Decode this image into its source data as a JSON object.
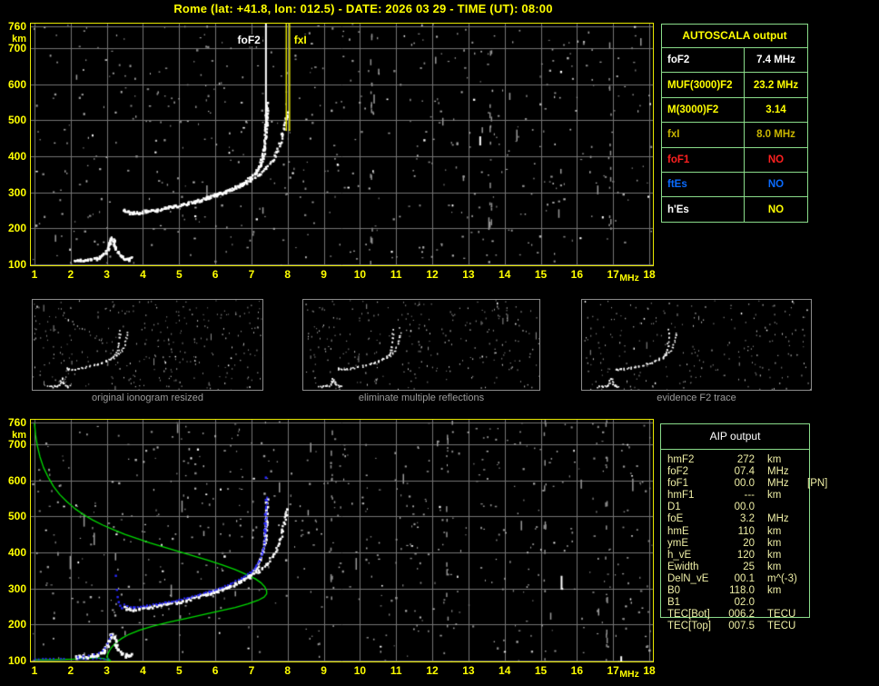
{
  "title": "Rome (lat: +41.8, lon: 012.5) - DATE: 2026 03 29 - TIME (UT): 08:00",
  "colors": {
    "title_yellow": "#ffff00",
    "plot_border": "#e9e900",
    "grid_gray": "#757575",
    "noise_gray": "#989898",
    "trace_white": "#ffffff",
    "profile_green": "#00dd00",
    "restored_blue": "#2828ff",
    "table_border_green": "#8adc8a",
    "aip_text": "#efefa6",
    "caption_gray": "#9c9c9c",
    "red": "#ff2020",
    "blue": "#0a6bff",
    "dark_yellow": "#c8b400"
  },
  "top_plot": {
    "x_ticks": [
      1,
      2,
      3,
      4,
      5,
      6,
      7,
      8,
      9,
      10,
      11,
      12,
      13,
      14,
      15,
      16,
      17,
      18
    ],
    "x_unit": "MHz",
    "y_ticks": [
      760,
      700,
      600,
      500,
      400,
      300,
      200,
      100
    ],
    "y_unit": "km",
    "foF2_label": "foF2",
    "fxI_label": "fxI"
  },
  "bottom_plot": {
    "x_ticks": [
      1,
      2,
      3,
      4,
      5,
      6,
      7,
      8,
      9,
      10,
      11,
      12,
      13,
      14,
      15,
      16,
      17,
      18
    ],
    "x_unit": "MHz",
    "y_ticks": [
      760,
      700,
      600,
      500,
      400,
      300,
      200,
      100
    ],
    "y_unit": "km"
  },
  "thumbnails": [
    {
      "caption": "original ionogram resized"
    },
    {
      "caption": "eliminate multiple reflections"
    },
    {
      "caption": "evidence F2 trace"
    }
  ],
  "autoscala": {
    "title": "AUTOSCALA output",
    "rows": [
      {
        "label": "foF2",
        "value": "7.4 MHz",
        "color": "#ffffff"
      },
      {
        "label": "MUF(3000)F2",
        "value": "23.2 MHz",
        "color": "#ffff00"
      },
      {
        "label": "M(3000)F2",
        "value": "3.14",
        "color": "#ffff00"
      },
      {
        "label": "fxI",
        "value": "8.0 MHz",
        "color": "#c8b400"
      },
      {
        "label": "foF1",
        "value": "NO",
        "color": "#ff2020"
      },
      {
        "label": "ftEs",
        "value": "NO",
        "color": "#0a6bff"
      },
      {
        "label": "h'Es",
        "value": "NO",
        "color": "#ffffff",
        "value_color": "#ffff00"
      }
    ]
  },
  "aip": {
    "title": "AIP output",
    "rows": [
      {
        "label": "hmF2",
        "value": "272",
        "unit": "km",
        "extra": ""
      },
      {
        "label": "foF2",
        "value": "07.4",
        "unit": "MHz",
        "extra": ""
      },
      {
        "label": "foF1",
        "value": "00.0",
        "unit": "MHz",
        "extra": "[PN]"
      },
      {
        "label": "hmF1",
        "value": "---",
        "unit": "km",
        "extra": ""
      },
      {
        "label": "D1",
        "value": "00.0",
        "unit": "",
        "extra": ""
      },
      {
        "label": "foE",
        "value": "3.2",
        "unit": "MHz",
        "extra": ""
      },
      {
        "label": "hmE",
        "value": "110",
        "unit": "km",
        "extra": ""
      },
      {
        "label": "ymE",
        "value": "20",
        "unit": "km",
        "extra": ""
      },
      {
        "label": "h_vE",
        "value": "120",
        "unit": "km",
        "extra": ""
      },
      {
        "label": "Ewidth",
        "value": "25",
        "unit": "km",
        "extra": ""
      },
      {
        "label": "DelN_vE",
        "value": "00.1",
        "unit": "m^(-3)",
        "extra": ""
      },
      {
        "label": "B0",
        "value": "118.0",
        "unit": "km",
        "extra": ""
      },
      {
        "label": "B1",
        "value": "02.0",
        "unit": "",
        "extra": ""
      },
      {
        "label": "TEC[Bot]",
        "value": "006.2",
        "unit": "TECU",
        "extra": ""
      },
      {
        "label": "TEC[Top]",
        "value": "007.5",
        "unit": "TECU",
        "extra": ""
      }
    ]
  },
  "chart_data": {
    "type": "scatter",
    "title": "Ionogram echo traces, virtual height vs frequency",
    "xlabel": "MHz",
    "ylabel": "km",
    "x_range": [
      1,
      18
    ],
    "y_range": [
      100,
      760
    ],
    "markers": {
      "foF2_MHz": 7.4,
      "fxI_MHz": 8.0
    },
    "o_trace": [
      [
        3.45,
        252
      ],
      [
        3.55,
        247
      ],
      [
        3.7,
        244
      ],
      [
        3.9,
        246
      ],
      [
        4.1,
        249
      ],
      [
        4.35,
        253
      ],
      [
        4.6,
        258
      ],
      [
        4.9,
        264
      ],
      [
        5.2,
        271
      ],
      [
        5.5,
        279
      ],
      [
        5.8,
        288
      ],
      [
        6.1,
        298
      ],
      [
        6.4,
        310
      ],
      [
        6.7,
        325
      ],
      [
        6.95,
        342
      ],
      [
        7.1,
        357
      ],
      [
        7.2,
        374
      ],
      [
        7.28,
        396
      ],
      [
        7.33,
        423
      ],
      [
        7.36,
        452
      ],
      [
        7.38,
        487
      ],
      [
        7.39,
        518
      ],
      [
        7.4,
        548
      ]
    ],
    "x_trace": [
      [
        5.75,
        286
      ],
      [
        6.05,
        295
      ],
      [
        6.35,
        306
      ],
      [
        6.65,
        319
      ],
      [
        6.95,
        334
      ],
      [
        7.2,
        351
      ],
      [
        7.4,
        370
      ],
      [
        7.55,
        390
      ],
      [
        7.67,
        412
      ],
      [
        7.76,
        437
      ],
      [
        7.83,
        462
      ],
      [
        7.88,
        487
      ],
      [
        7.93,
        508
      ],
      [
        7.96,
        525
      ]
    ],
    "es_trace": [
      [
        2.1,
        112
      ],
      [
        2.25,
        114
      ],
      [
        2.4,
        113
      ],
      [
        2.55,
        116
      ],
      [
        2.7,
        118
      ],
      [
        2.8,
        122
      ],
      [
        2.9,
        130
      ],
      [
        3.0,
        144
      ],
      [
        3.05,
        160
      ],
      [
        3.1,
        176
      ],
      [
        3.16,
        166
      ],
      [
        3.22,
        149
      ],
      [
        3.28,
        135
      ],
      [
        3.38,
        124
      ],
      [
        3.48,
        117
      ],
      [
        3.58,
        114
      ],
      [
        3.68,
        120
      ]
    ],
    "green_profile": [
      [
        1.0,
        758
      ],
      [
        1.03,
        725
      ],
      [
        1.08,
        695
      ],
      [
        1.15,
        665
      ],
      [
        1.25,
        635
      ],
      [
        1.38,
        608
      ],
      [
        1.53,
        582
      ],
      [
        1.7,
        560
      ],
      [
        1.9,
        540
      ],
      [
        2.12,
        521
      ],
      [
        2.35,
        505
      ],
      [
        2.6,
        490
      ],
      [
        2.88,
        476
      ],
      [
        3.18,
        463
      ],
      [
        3.5,
        450
      ],
      [
        3.85,
        438
      ],
      [
        4.2,
        426
      ],
      [
        4.6,
        414
      ],
      [
        5.0,
        402
      ],
      [
        5.4,
        390
      ],
      [
        5.8,
        378
      ],
      [
        6.2,
        365
      ],
      [
        6.55,
        352
      ],
      [
        6.85,
        339
      ],
      [
        7.1,
        327
      ],
      [
        7.27,
        315
      ],
      [
        7.37,
        304
      ],
      [
        7.42,
        293
      ],
      [
        7.42,
        285
      ],
      [
        7.35,
        276
      ],
      [
        7.18,
        267
      ],
      [
        6.9,
        257
      ],
      [
        6.55,
        247
      ],
      [
        6.15,
        238
      ],
      [
        5.7,
        228
      ],
      [
        5.2,
        217
      ],
      [
        4.7,
        206
      ],
      [
        4.25,
        195
      ],
      [
        3.9,
        184
      ],
      [
        3.62,
        173
      ],
      [
        3.42,
        162
      ],
      [
        3.27,
        151
      ],
      [
        3.16,
        140
      ],
      [
        3.08,
        129
      ],
      [
        3.03,
        119
      ],
      [
        3.0,
        110
      ],
      [
        3.06,
        103
      ],
      [
        3.1,
        100
      ],
      [
        2.92,
        105
      ],
      [
        2.72,
        108
      ],
      [
        2.45,
        106
      ],
      [
        2.1,
        104
      ],
      [
        1.7,
        103
      ],
      [
        1.3,
        102
      ],
      [
        1.0,
        102
      ]
    ],
    "blue_h_line": [
      [
        1.0,
        107
      ],
      [
        3.0,
        107
      ]
    ],
    "blue_cusp": [
      [
        3.25,
        335
      ],
      [
        3.28,
        296
      ],
      [
        3.3,
        276
      ],
      [
        3.33,
        262
      ],
      [
        3.37,
        252
      ],
      [
        3.42,
        245
      ]
    ],
    "blue_high": [
      [
        7.36,
        462
      ],
      [
        7.37,
        480
      ],
      [
        7.38,
        505
      ],
      [
        7.4,
        545
      ],
      [
        7.4,
        607
      ]
    ],
    "blue_es_points": [
      [
        2.2,
        110
      ],
      [
        2.35,
        112
      ],
      [
        2.5,
        114
      ],
      [
        2.65,
        117
      ],
      [
        2.78,
        121
      ],
      [
        2.88,
        127
      ],
      [
        2.95,
        135
      ],
      [
        3.02,
        147
      ],
      [
        3.08,
        160
      ],
      [
        3.12,
        170
      ]
    ]
  }
}
